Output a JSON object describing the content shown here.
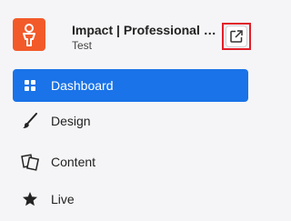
{
  "site": {
    "title": "Impact | Professional Con...",
    "subtitle": "Test",
    "logo_color": "#f25a29",
    "open_icon": "external-link-icon"
  },
  "nav": {
    "items": [
      {
        "label": "Dashboard",
        "icon": "grid-icon",
        "active": true
      },
      {
        "label": "Design",
        "icon": "brush-icon",
        "active": false
      },
      {
        "label": "Content",
        "icon": "pages-icon",
        "active": false
      },
      {
        "label": "Live",
        "icon": "star-icon",
        "active": false
      }
    ]
  },
  "colors": {
    "accent": "#1a73e8",
    "highlight": "#e0202a",
    "background": "#f5f5f7"
  }
}
